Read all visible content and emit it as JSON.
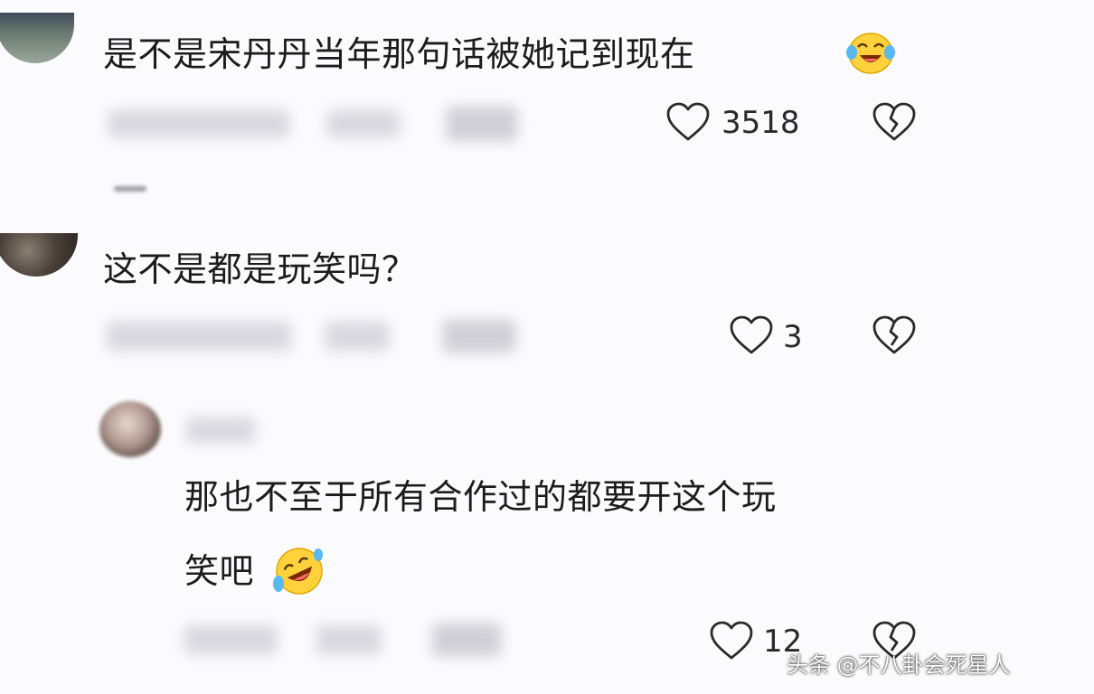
{
  "comments": [
    {
      "text": "是不是宋丹丹当年那句话被她记到现在",
      "emoji": "crying-laughing-emoji",
      "likes": "3518"
    },
    {
      "text": "这不是都是玩笑吗？",
      "likes": "3"
    }
  ],
  "reply": {
    "text_line1": "那也不至于所有合作过的都要开这个玩",
    "text_line2": "笑吧",
    "emoji": "rolling-on-floor-laughing-emoji",
    "likes": "12"
  },
  "watermark": "头条 @不八卦会死星人",
  "icons": {
    "like": "heart-outline-icon",
    "dislike": "broken-heart-icon"
  }
}
